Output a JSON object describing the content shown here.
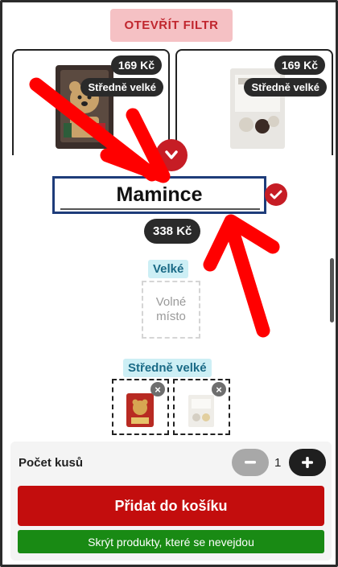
{
  "header": {
    "filter_button_label": "OTEVŘÍT FILTR"
  },
  "product_cards": [
    {
      "price": "169 Kč",
      "size": "Středně velké",
      "image": "chocolate-teddy-bear-box"
    },
    {
      "price": "169 Kč",
      "size": "Středně velké",
      "image": "white-chocolate-box"
    }
  ],
  "gift_box": {
    "name_value": "Mamince",
    "total_price": "338 Kč",
    "categories": [
      {
        "label": "Velké",
        "empty_slot_text_1": "Volné",
        "empty_slot_text_2": "místo"
      },
      {
        "label": "Středně velké",
        "items": [
          "chocolate-teddy-bear-box",
          "white-chocolate-box"
        ],
        "remove_label": "×"
      }
    ]
  },
  "bottom": {
    "qty_label": "Počet kusů",
    "qty_value": "1",
    "minus_label": "−",
    "plus_label": "+",
    "add_to_cart_label": "Přidat do košíku",
    "hide_products_label": "Skrýt produkty, které se nevejdou"
  },
  "colors": {
    "accent_red": "#c30d0d",
    "filter_bg": "#f5c1c4",
    "success_green": "#198a14",
    "annotation_arrow": "#ff0000",
    "category_label_bg": "#cdeff5"
  }
}
